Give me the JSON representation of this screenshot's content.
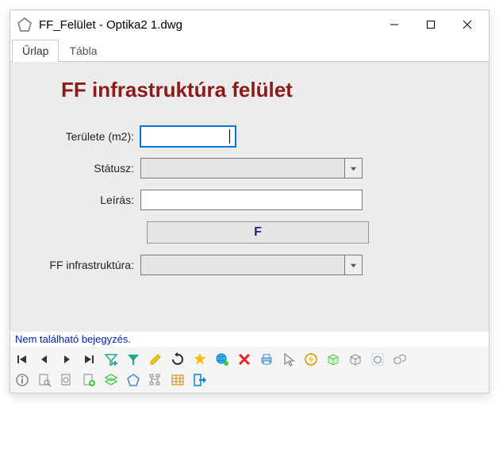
{
  "window": {
    "title": "FF_Felület - Optika2 1.dwg"
  },
  "tabs": {
    "form": "Űrlap",
    "table": "Tábla"
  },
  "form": {
    "heading": "FF infrastruktúra felület",
    "area_label": "Területe (m2):",
    "area_value": "",
    "status_label": "Státusz:",
    "status_value": "",
    "desc_label": "Leírás:",
    "desc_value": "",
    "f_button": "F",
    "infra_label": "FF infrastruktúra:",
    "infra_value": ""
  },
  "status_text": "Nem található bejegyzés.",
  "icons": {
    "app": "pentagon-icon",
    "min": "minimize-icon",
    "max": "maximize-icon",
    "close": "close-icon"
  }
}
